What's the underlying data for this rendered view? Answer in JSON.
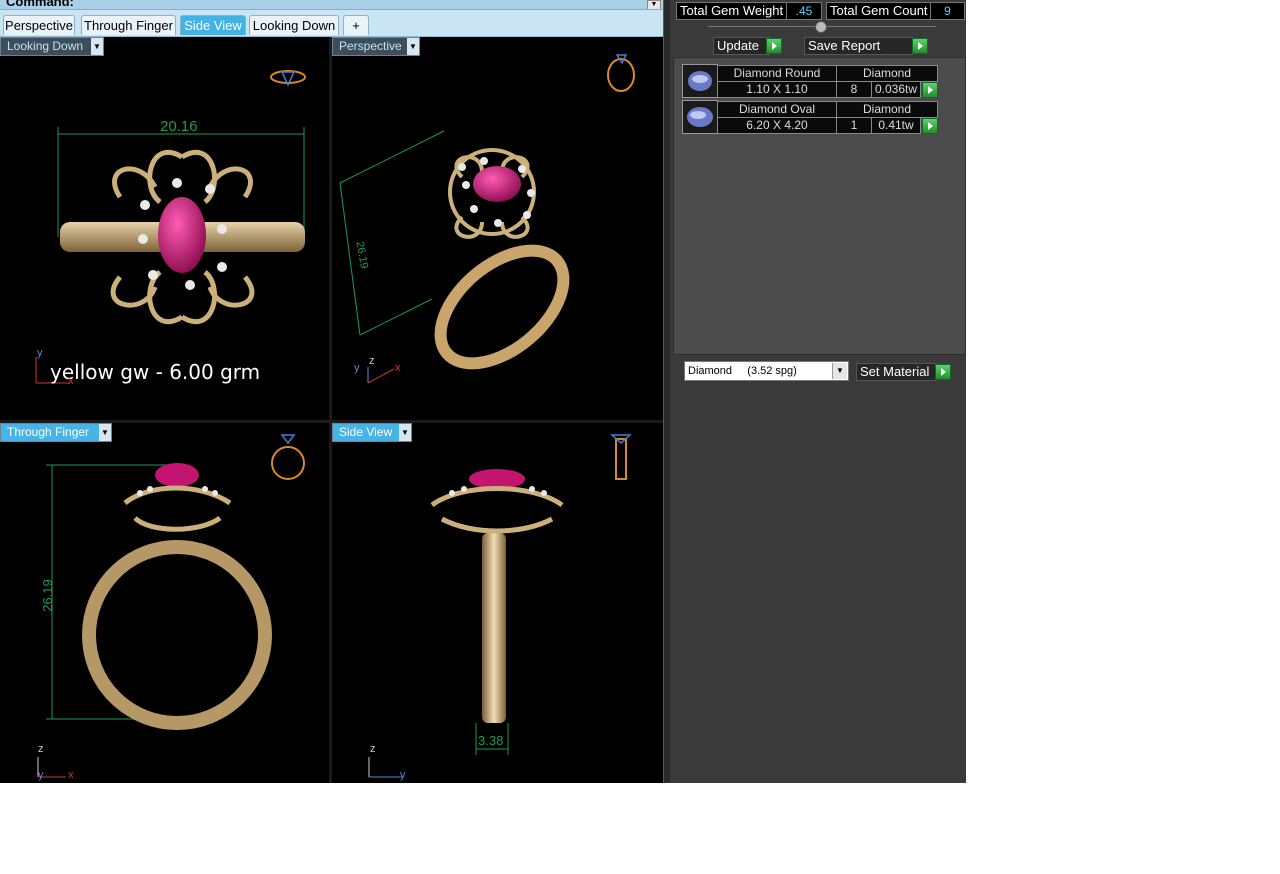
{
  "command_bar": {
    "label": "Command:"
  },
  "tabs": [
    {
      "label": "Perspective"
    },
    {
      "label": "Through Finger"
    },
    {
      "label": "Side View"
    },
    {
      "label": "Looking Down"
    }
  ],
  "add_tab_label": "+",
  "viewports": {
    "top_left": {
      "label": "Looking Down",
      "dimension": "20.16",
      "overlay_text": "yellow gw - 6.00 grm",
      "axis_y": "y",
      "axis_x": "x"
    },
    "top_right": {
      "label": "Perspective",
      "dimension": "26.19",
      "axis_z": "z",
      "axis_x": "x",
      "axis_y": "y"
    },
    "bottom_left": {
      "label": "Through Finger",
      "dimension": "26.19",
      "axis_z": "z",
      "axis_y": "y",
      "axis_x": "x"
    },
    "bottom_right": {
      "label": "Side View",
      "dimension": "3.38",
      "axis_z": "z",
      "axis_y": "y"
    }
  },
  "totals": {
    "weight_label": "Total Gem Weight",
    "weight_value": ".45",
    "count_label": "Total Gem Count",
    "count_value": "9"
  },
  "buttons": {
    "update": "Update",
    "save_report": "Save Report",
    "set_material": "Set Material"
  },
  "gems": [
    {
      "name": "Diamond Round",
      "material": "Diamond",
      "size": "1.10 X 1.10",
      "count": "8",
      "weight": "0.036tw"
    },
    {
      "name": "Diamond Oval",
      "material": "Diamond",
      "size": "6.20 X 4.20",
      "count": "1",
      "weight": "0.41tw"
    }
  ],
  "material_select": {
    "value": "Diamond     (3.52 spg)"
  },
  "colors": {
    "gem": "#d0157a",
    "gold": "#c9a56b",
    "dimension": "#1e9a55",
    "tab_active": "#43b3e5",
    "value_text": "#4fd2ff"
  }
}
